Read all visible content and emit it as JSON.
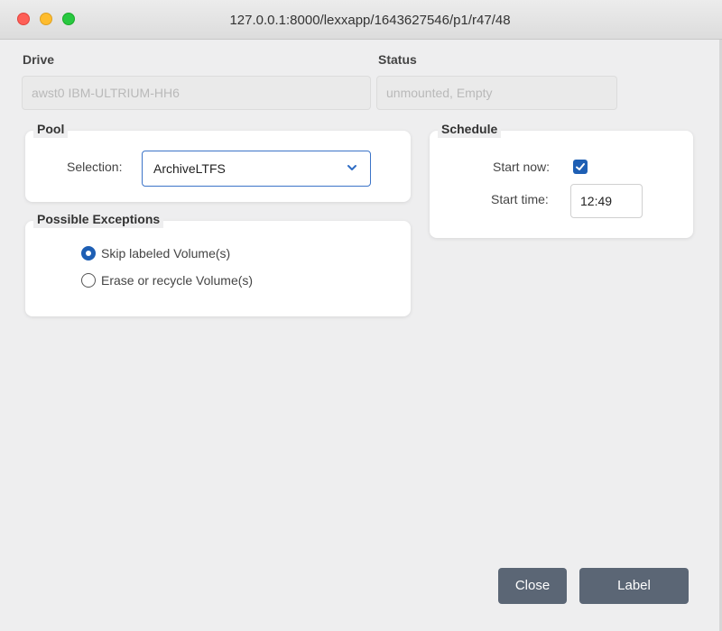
{
  "window": {
    "title": "127.0.0.1:8000/lexxapp/1643627546/p1/r47/48"
  },
  "drive": {
    "label": "Drive",
    "value": "awst0 IBM-ULTRIUM-HH6"
  },
  "status": {
    "label": "Status",
    "value": "unmounted, Empty"
  },
  "pool": {
    "title": "Pool",
    "selection_label": "Selection:",
    "selected": "ArchiveLTFS"
  },
  "exceptions": {
    "title": "Possible Exceptions",
    "options": [
      {
        "label": "Skip labeled Volume(s)",
        "selected": true
      },
      {
        "label": "Erase or recycle Volume(s)",
        "selected": false
      }
    ]
  },
  "schedule": {
    "title": "Schedule",
    "start_now_label": "Start now:",
    "start_now_checked": true,
    "start_time_label": "Start time:",
    "start_time_value": "12:49"
  },
  "buttons": {
    "close": "Close",
    "label": "Label"
  },
  "colors": {
    "accent": "#1e5fb4",
    "button": "#5b6675"
  }
}
